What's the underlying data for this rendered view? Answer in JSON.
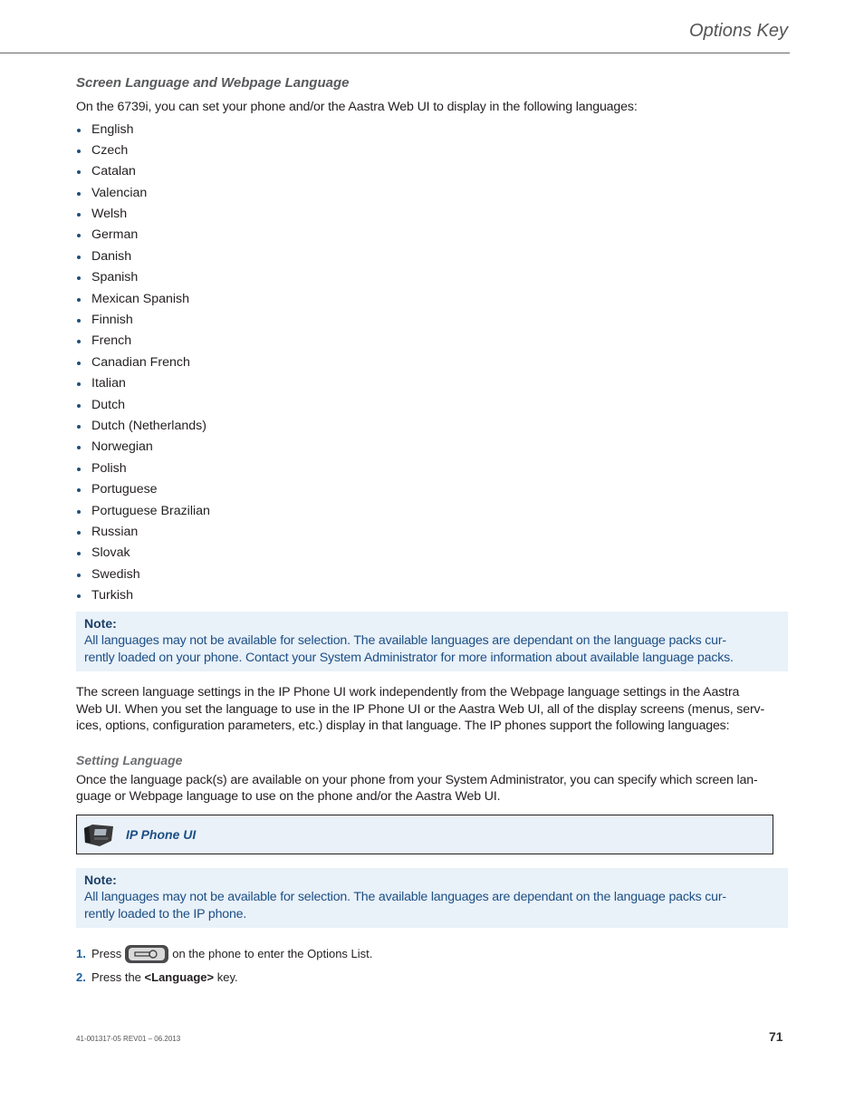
{
  "header": {
    "title": "Options Key"
  },
  "section": {
    "heading": "Screen Language and Webpage Language",
    "intro": "On the 6739i, you can set your phone and/or the Aastra Web UI to display in the following languages:",
    "languages": [
      "English",
      "Czech",
      "Catalan",
      "Valencian",
      "Welsh",
      "German",
      "Danish",
      "Spanish",
      "Mexican Spanish",
      "Finnish",
      "French",
      "Canadian French",
      "Italian",
      "Dutch",
      "Dutch (Netherlands)",
      "Norwegian",
      "Polish",
      "Portuguese",
      "Portuguese Brazilian",
      "Russian",
      "Slovak",
      "Swedish",
      "Turkish"
    ],
    "note1": {
      "title": "Note:",
      "line1": "All languages may not be available for selection. The available languages are dependant on the language packs cur-",
      "line2": "rently loaded on your phone. Contact your System Administrator for more information about available language packs."
    },
    "paragraph": {
      "line1": "The screen language settings in the IP Phone UI work independently from the Webpage language settings in the Aastra",
      "line2": "Web UI. When you set the language to use in the IP Phone UI or the Aastra Web UI, all of the display screens (menus, serv-",
      "line3": "ices, options, configuration parameters, etc.) display in that language. The IP phones support the following languages:"
    }
  },
  "setting": {
    "heading": "Setting Language",
    "line1": "Once the language pack(s) are available on your phone from your System Administrator, you can specify which screen lan-",
    "line2": "guage or Webpage language to use on the phone and/or the Aastra Web UI.",
    "ui_box": {
      "icon": "desk-phone-icon",
      "label": "IP Phone UI"
    },
    "note2": {
      "title": "Note:",
      "line1": "All languages may not be available for selection. The available languages are dependant on the language packs cur-",
      "line2": "rently loaded to the IP phone."
    },
    "steps": [
      {
        "num": "1.",
        "before": "Press",
        "icon": "options-key-icon",
        "after": "on the phone to enter the Options List."
      },
      {
        "num": "2.",
        "before": "Press the",
        "bold": "<Language>",
        "after": "key."
      }
    ]
  },
  "footer": {
    "doc_id": "41-001317-05 REV01 – 06.2013",
    "page_number": "71"
  },
  "colors": {
    "note_bg": "#e9f1f9",
    "note_text": "#1c4f85",
    "bullet": "#1f4e79",
    "step_num": "#1c5e9e"
  }
}
